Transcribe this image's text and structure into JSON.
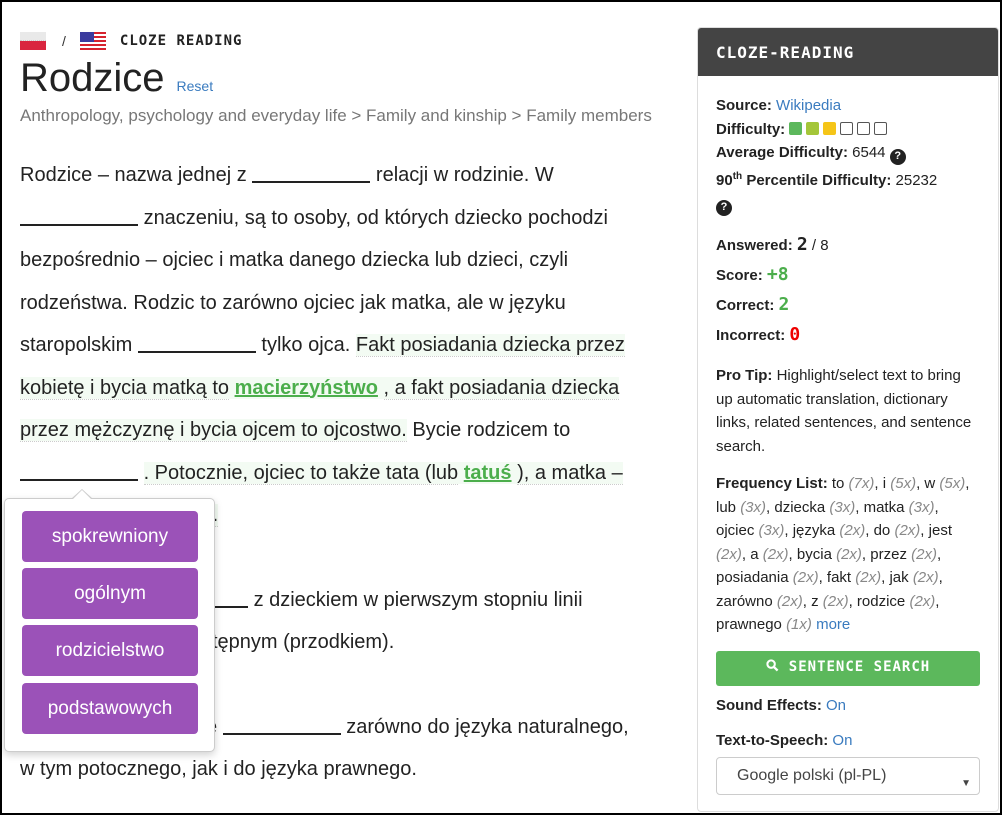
{
  "header": {
    "source_flag": "poland-flag",
    "target_flag": "usa-flag",
    "separator": "/",
    "mode_title": "CLOZE READING",
    "page_title": "Rodzice",
    "reset_label": "Reset",
    "category_path": "Anthropology, psychology and everyday life > Family and kinship > Family members"
  },
  "article": {
    "p1": {
      "t1": "Rodzice – nazwa jednej z",
      "t2": "relacji w rodzinie. W",
      "t3": "znaczeniu, są to osoby, od których dziecko pochodzi bezpośrednio – ojciec i matka danego dziecka lub dzieci, czyli rodzeństwa. Rodzic to zarówno ojciec jak matka, ale w języku staropolskim",
      "t4": "tylko ojca.",
      "h1": "Fakt posiadania dziecka przez kobietę i bycia matką to",
      "answer1": "macierzyństwo",
      "h2": ", a fakt posiadania dziecka przez mężczyznę i bycia ojcem to ojcostwo.",
      "t5": "Bycie rodzicem to",
      "h3": ". Potocznie, ojciec to także tata (lub",
      "answer2": "tatuś",
      "h4": "), a matka –",
      "h5": ")."
    },
    "p2": {
      "t2": "z dzieckiem w pierwszym stopniu linii",
      "t3": "tępnym (przodkiem)."
    },
    "p3": {
      "t1": "e",
      "t2": "zarówno do języka naturalnego,",
      "t3": "w tym potocznego, jak i do języka prawnego."
    }
  },
  "popover": {
    "options": [
      "spokrewniony",
      "ogólnym",
      "rodzicielstwo",
      "podstawowych"
    ]
  },
  "sidebar": {
    "title": "CLOZE-READING",
    "source_label": "Source:",
    "source_value": "Wikipedia",
    "difficulty_label": "Difficulty:",
    "difficulty_level": 3,
    "difficulty_max": 6,
    "difficulty_colors": [
      "#5cb85c",
      "#a4c639",
      "#f5c518"
    ],
    "avg_difficulty_label": "Average Difficulty:",
    "avg_difficulty_value": "6544",
    "percentile_sup": "th",
    "percentile_num": "90",
    "percentile_label": "Percentile Difficulty:",
    "percentile_value": "25232",
    "answered_label": "Answered:",
    "answered_value": "2",
    "answered_total": "/ 8",
    "score_label": "Score:",
    "score_value": "+8",
    "correct_label": "Correct:",
    "correct_value": "2",
    "incorrect_label": "Incorrect:",
    "incorrect_value": "0",
    "protip_label": "Pro Tip:",
    "protip_text": "Highlight/select text to bring up automatic translation, dictionary links, related sentences, and sentence search.",
    "freq_label": "Frequency List:",
    "freq_list": [
      {
        "word": "to",
        "count": "(7x)"
      },
      {
        "word": "i",
        "count": "(5x)"
      },
      {
        "word": "w",
        "count": "(5x)"
      },
      {
        "word": "lub",
        "count": "(3x)"
      },
      {
        "word": "dziecka",
        "count": "(3x)"
      },
      {
        "word": "matka",
        "count": "(3x)"
      },
      {
        "word": "ojciec",
        "count": "(3x)"
      },
      {
        "word": "języka",
        "count": "(2x)"
      },
      {
        "word": "do",
        "count": "(2x)"
      },
      {
        "word": "jest",
        "count": "(2x)"
      },
      {
        "word": "a",
        "count": "(2x)"
      },
      {
        "word": "bycia",
        "count": "(2x)"
      },
      {
        "word": "przez",
        "count": "(2x)"
      },
      {
        "word": "posiadania",
        "count": "(2x)"
      },
      {
        "word": "fakt",
        "count": "(2x)"
      },
      {
        "word": "jak",
        "count": "(2x)"
      },
      {
        "word": "zarówno",
        "count": "(2x)"
      },
      {
        "word": "z",
        "count": "(2x)"
      },
      {
        "word": "rodzice",
        "count": "(2x)"
      },
      {
        "word": "prawnego",
        "count": "(1x)"
      }
    ],
    "more_label": "more",
    "search_button_label": "SENTENCE SEARCH",
    "sound_label": "Sound Effects:",
    "sound_value": "On",
    "tts_label": "Text-to-Speech:",
    "tts_value": "On",
    "voice_selected": "Google polski (pl-PL)"
  }
}
